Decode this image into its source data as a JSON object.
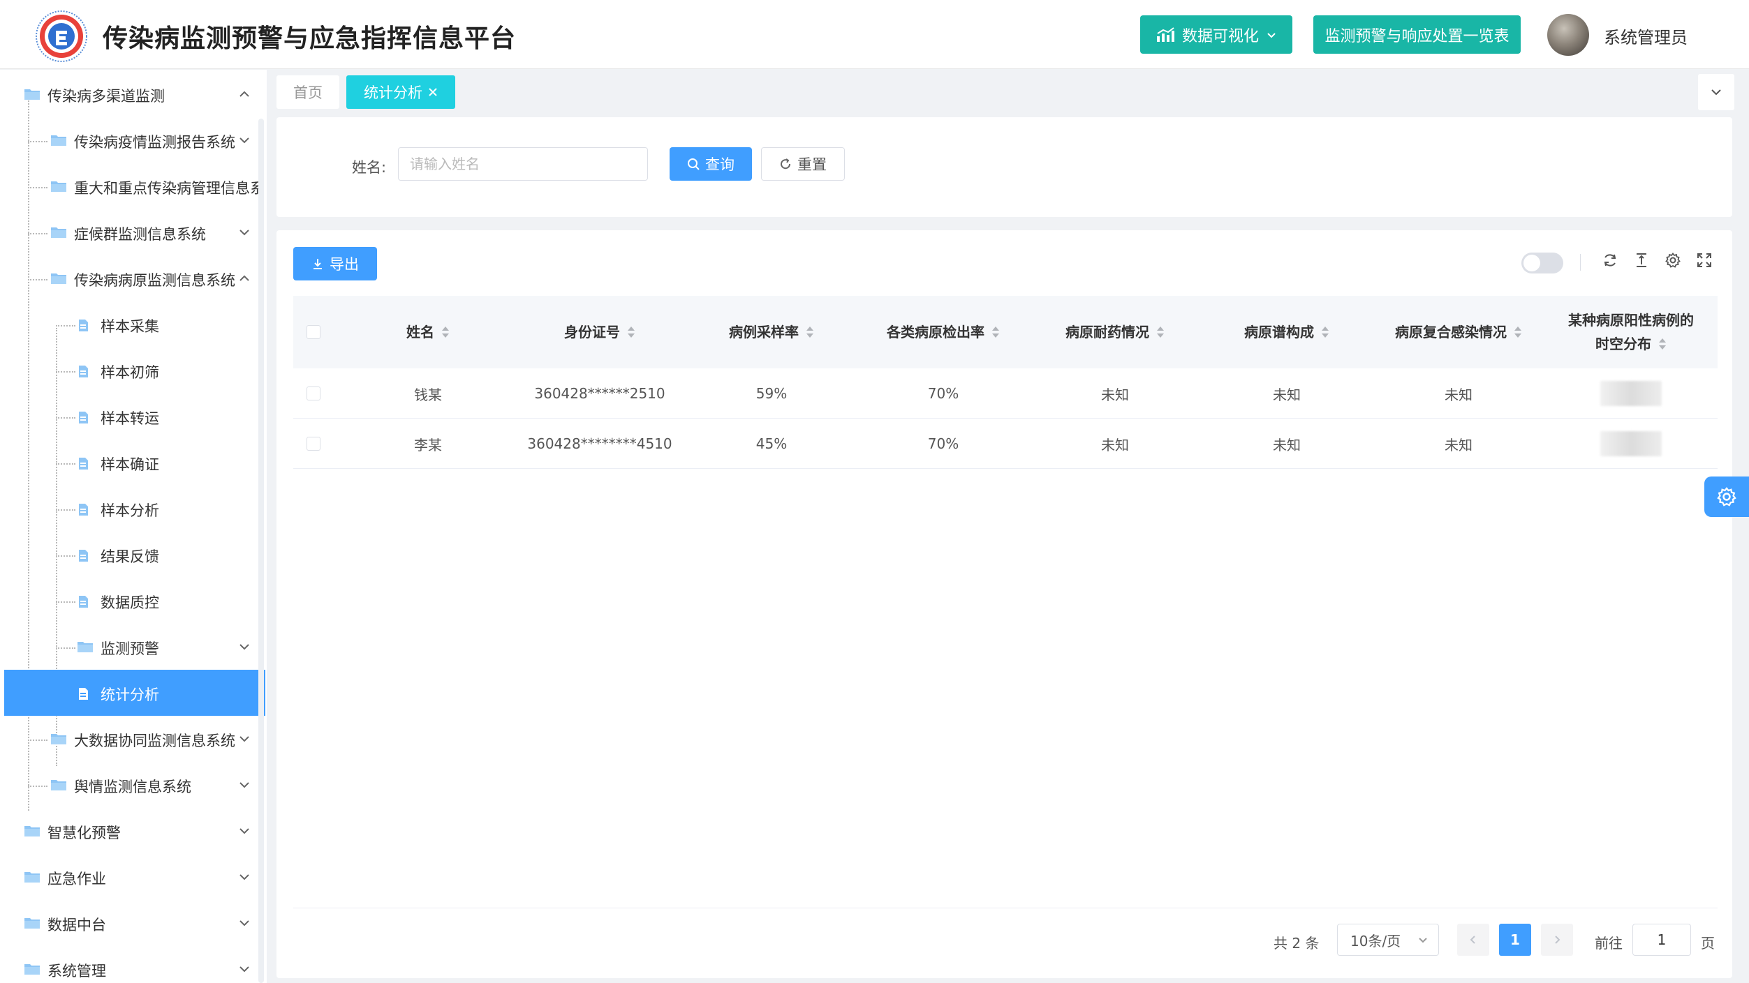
{
  "header": {
    "title": "传染病监测预警与应急指挥信息平台",
    "viz_button": "数据可视化",
    "list_button": "监测预警与响应处置一览表",
    "username": "系统管理员"
  },
  "sidebar": {
    "items": [
      {
        "label": "传染病多渠道监测"
      },
      {
        "label": "传染病疫情监测报告系统"
      },
      {
        "label": "重大和重点传染病管理信息系"
      },
      {
        "label": "症候群监测信息系统"
      },
      {
        "label": "传染病病原监测信息系统"
      },
      {
        "label": "样本采集"
      },
      {
        "label": "样本初筛"
      },
      {
        "label": "样本转运"
      },
      {
        "label": "样本确证"
      },
      {
        "label": "样本分析"
      },
      {
        "label": "结果反馈"
      },
      {
        "label": "数据质控"
      },
      {
        "label": "监测预警"
      },
      {
        "label": "统计分析"
      },
      {
        "label": "大数据协同监测信息系统"
      },
      {
        "label": "舆情监测信息系统"
      },
      {
        "label": "智慧化预警"
      },
      {
        "label": "应急作业"
      },
      {
        "label": "数据中台"
      },
      {
        "label": "系统管理"
      }
    ]
  },
  "tabs": {
    "home": "首页",
    "active": "统计分析"
  },
  "search": {
    "label": "姓名:",
    "placeholder": "请输入姓名",
    "query_button": "查询",
    "reset_button": "重置"
  },
  "toolbar": {
    "export_button": "导出"
  },
  "table": {
    "columns": [
      "姓名",
      "身份证号",
      "病例采样率",
      "各类病原检出率",
      "病原耐药情况",
      "病原谱构成",
      "病原复合感染情况",
      "某种病原阳性病例的",
      "时空分布"
    ],
    "rows": [
      {
        "name": "钱某",
        "id": "360428******2510",
        "sampling": "59%",
        "detection": "70%",
        "resistance": "未知",
        "spectrum": "未知",
        "coinfection": "未知"
      },
      {
        "name": "李某",
        "id": "360428********4510",
        "sampling": "45%",
        "detection": "70%",
        "resistance": "未知",
        "spectrum": "未知",
        "coinfection": "未知"
      }
    ]
  },
  "pagination": {
    "total": "共 2 条",
    "page_size": "10条/页",
    "current": "1",
    "goto_label": "前往",
    "goto_value": "1",
    "page_suffix": "页"
  },
  "colors": {
    "primary": "#409eff",
    "teal": "#19b6a6",
    "tab_active": "#1fd0e0"
  }
}
